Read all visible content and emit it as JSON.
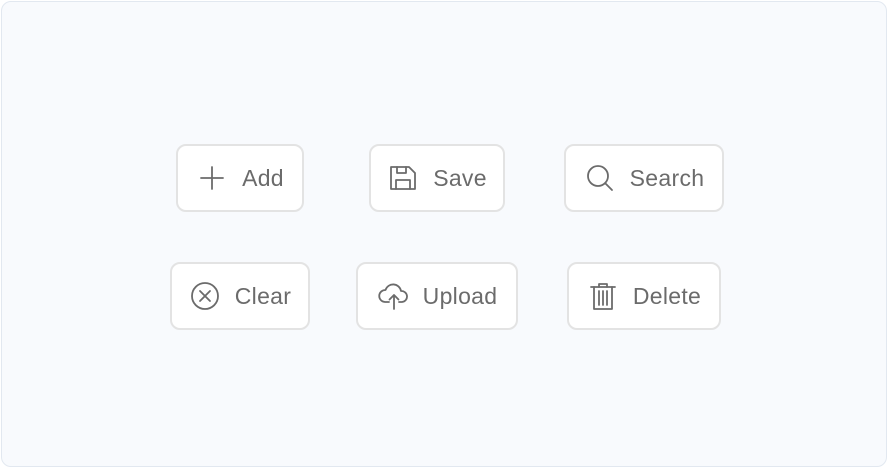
{
  "buttons": {
    "add": {
      "label": "Add",
      "icon": "plus-icon"
    },
    "save": {
      "label": "Save",
      "icon": "floppy-disk-icon"
    },
    "search": {
      "label": "Search",
      "icon": "magnifier-icon"
    },
    "clear": {
      "label": "Clear",
      "icon": "circle-x-icon"
    },
    "upload": {
      "label": "Upload",
      "icon": "cloud-upload-icon"
    },
    "delete": {
      "label": "Delete",
      "icon": "trash-icon"
    }
  },
  "colors": {
    "background": "#f8fafd",
    "button_bg": "#ffffff",
    "button_border": "#e3e3e3",
    "text": "#6b6b6b"
  }
}
